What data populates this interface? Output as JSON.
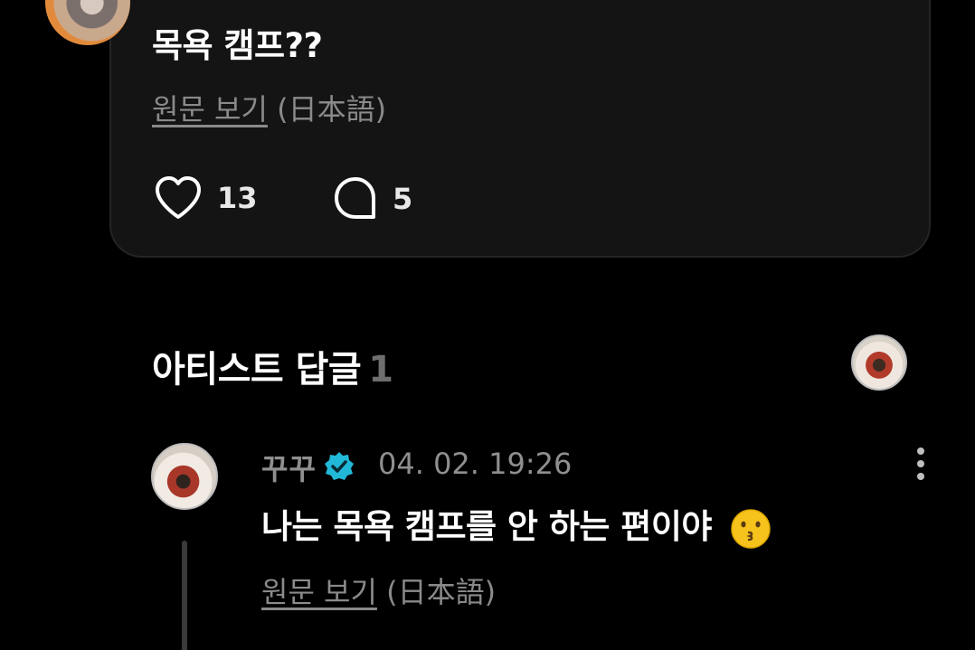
{
  "post": {
    "text": "목욕 캠프??",
    "translate_link": "원문 보기",
    "translate_lang": "(日本語)",
    "like_count": "13",
    "comment_count": "5"
  },
  "artist_replies": {
    "title": "아티스트 답글",
    "count": "1"
  },
  "reply": {
    "author": "꾸꾸",
    "date": "04. 02. 19:26",
    "text": "나는 목욕 캠프를 안 하는 편이야",
    "emoji": "kissing-face-icon",
    "translate_link": "원문 보기",
    "translate_lang": "(日本語)"
  },
  "colors": {
    "background": "#000000",
    "card": "#141414",
    "muted_text": "#8a8a8a",
    "verified": "#22b8d8"
  }
}
